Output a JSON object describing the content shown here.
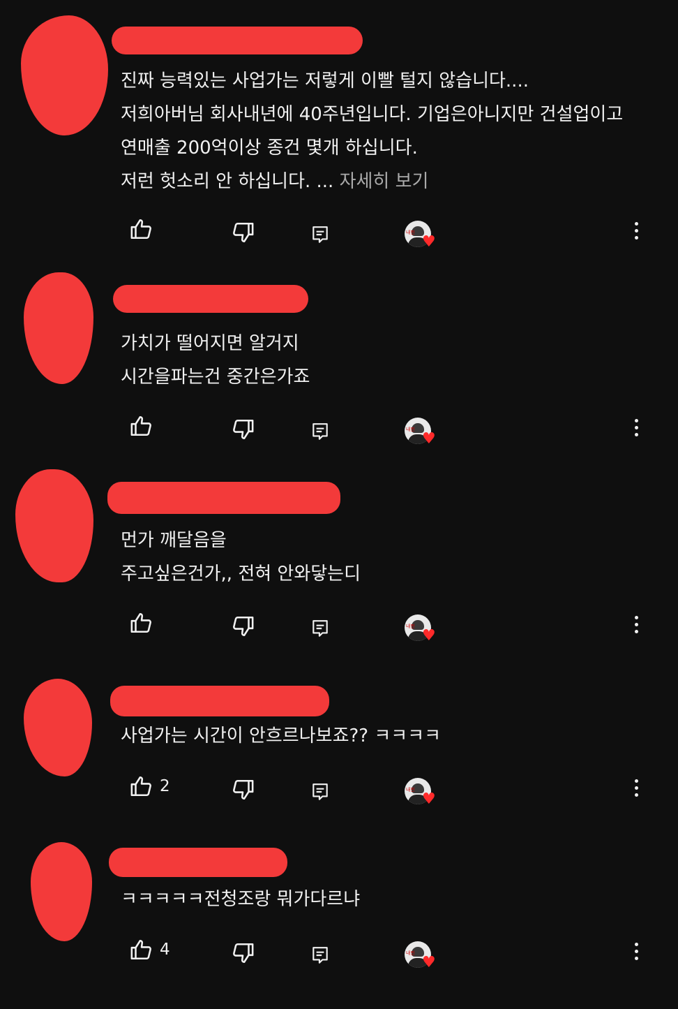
{
  "comments": [
    {
      "lines": [
        "진짜 능력있는 사업가는 저렇게 이빨 털지 않습니다....",
        "저희아버님 회사내년에 40주년입니다. 기업은아니지만 건설업이고",
        "연매출 200억이상  종건 몇개 하십니다.",
        "저런 헛소리 안 하십니다. ..."
      ],
      "read_more": "자세히 보기",
      "like_count": ""
    },
    {
      "lines": [
        "가치가 떨어지면 알거지",
        "시간을파는건 중간은가죠"
      ],
      "like_count": ""
    },
    {
      "lines": [
        "먼가 깨달음을",
        "주고싶은건가,, 전혀 안와닿는디"
      ],
      "like_count": ""
    },
    {
      "lines": [
        "사업가는 시간이 안흐르나보죠?? ㅋㅋㅋㅋ"
      ],
      "like_count": "2"
    },
    {
      "lines": [
        "ㅋㅋㅋㅋㅋ전청조랑 뭐가다르냐"
      ],
      "like_count": "4"
    }
  ],
  "creator_badge_text": "내핀",
  "icons": {
    "like": "thumbs-up-icon",
    "dislike": "thumbs-down-icon",
    "reply": "reply-icon",
    "creator_heart": "creator-heart-icon",
    "more": "more-vertical-icon"
  },
  "colors": {
    "background": "#0f0f0f",
    "text": "#f1f1f1",
    "muted": "#aaaaaa",
    "redaction": "#f33a3a",
    "heart": "#ff2a2a"
  }
}
